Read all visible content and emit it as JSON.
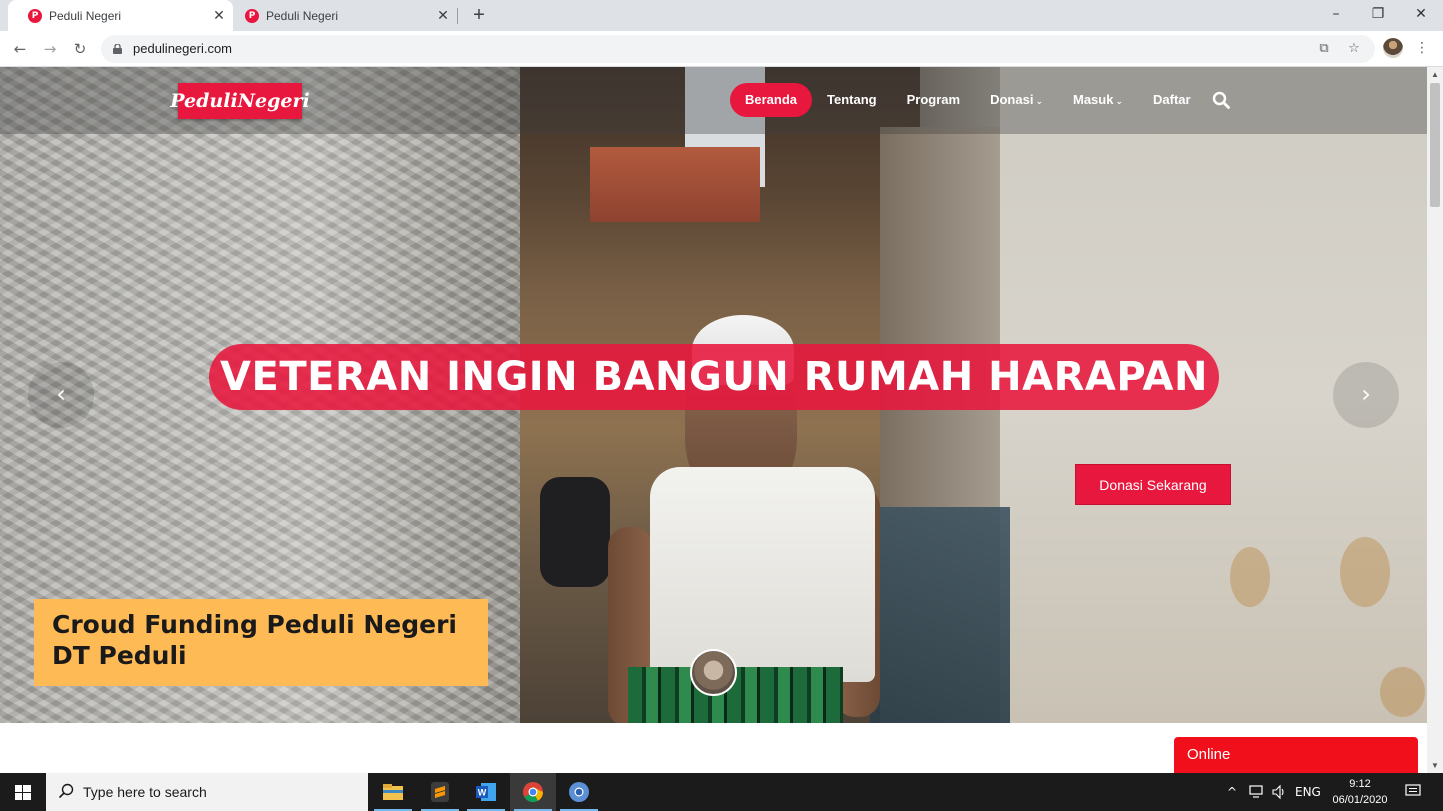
{
  "browser": {
    "tabs": [
      {
        "title": "Peduli Negeri",
        "favicon": "P",
        "active": true
      },
      {
        "title": "Peduli Negeri",
        "favicon": "P",
        "active": false
      }
    ],
    "new_tab_icon": "plus-icon",
    "window_controls": {
      "minimize": "–",
      "maximize": "❐",
      "close": "✕"
    },
    "nav": {
      "back": "←",
      "forward": "→",
      "reload": "↻"
    },
    "url": "pedulinegeri.com",
    "omnibox_icons": [
      "translate-icon",
      "star-icon"
    ]
  },
  "site": {
    "logo": "PeduliNegeri",
    "nav": [
      {
        "label": "Beranda",
        "active": true
      },
      {
        "label": "Tentang"
      },
      {
        "label": "Program"
      },
      {
        "label": "Donasi",
        "caret": "⌄"
      },
      {
        "label": "Masuk",
        "caret": "⌄"
      },
      {
        "label": "Daftar"
      }
    ],
    "slide_title": "VETERAN INGIN BANGUN RUMAH HARAPAN",
    "donate_button": "Donasi Sekarang",
    "prev_arrow": "‹",
    "next_arrow": "›",
    "caption_line1": "Croud Funding Peduli Negeri",
    "caption_line2": "DT Peduli",
    "online_tab": "Online",
    "accent_color": "#e8173e",
    "caption_color": "#fdba55"
  },
  "taskbar": {
    "search_placeholder": "Type here to search",
    "apps": [
      "file-explorer-icon",
      "sublime-text-icon",
      "word-icon",
      "chrome-icon",
      "chrome-alt-icon"
    ],
    "tray": {
      "chevron": "^",
      "language": "ENG"
    },
    "time": "9:12",
    "date": "06/01/2020"
  }
}
